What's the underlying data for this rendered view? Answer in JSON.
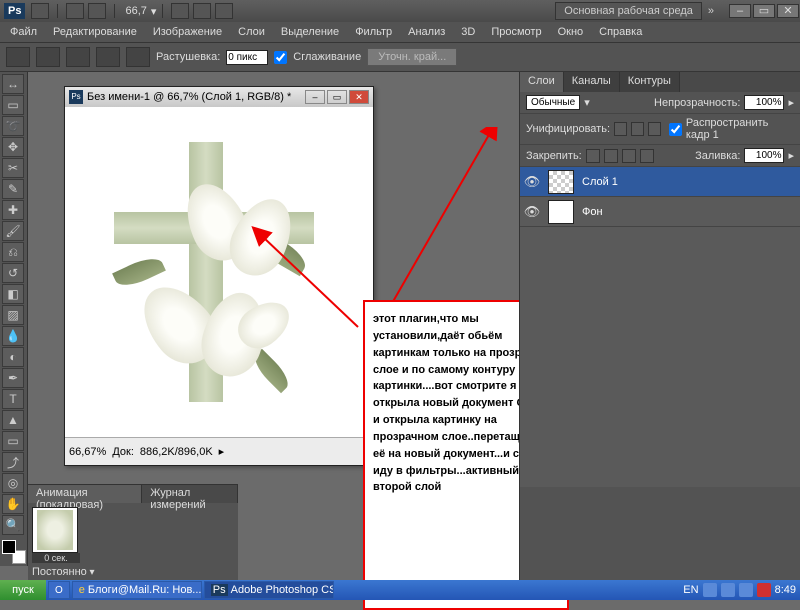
{
  "titlebar": {
    "ps": "Ps",
    "zoom": "66,7",
    "workspace": "Основная рабочая среда"
  },
  "menu": {
    "file": "Файл",
    "edit": "Редактирование",
    "image": "Изображение",
    "layers": "Слои",
    "select": "Выделение",
    "filter": "Фильтр",
    "analysis": "Анализ",
    "d3": "3D",
    "view": "Просмотр",
    "window": "Окно",
    "help": "Справка"
  },
  "optbar": {
    "feather_label": "Растушевка:",
    "feather_value": "0 пикс",
    "aa_label": "Сглаживание",
    "aa_checked": true,
    "refine": "Уточн. край..."
  },
  "doc": {
    "title": "Без имени-1 @ 66,7% (Слой 1, RGB/8) *",
    "zoom": "66,67%",
    "doc_label": "Док:",
    "doc_size": "886,2K/896,0K"
  },
  "annotation": {
    "text": "этот плагин,что мы установили,даёт обьём картинкам только на прозрачном слое и по самому контуру картинки....вот смотрите я открыла новый документ Ctrl+N  и открыла картинку на прозрачном слое..перетащщила её на новый документ...и сейчас иду в фильтры...активный у меня второй слой"
  },
  "anim": {
    "tab1": "Анимация (покадровая)",
    "tab2": "Журнал измерений",
    "time": "0 сек.",
    "loop": "Постоянно"
  },
  "layers_panel": {
    "tabs": {
      "layers": "Слои",
      "channels": "Каналы",
      "paths": "Контуры"
    },
    "blend": "Обычные",
    "opacity_label": "Непрозрачность:",
    "opacity": "100%",
    "unify": "Унифицировать:",
    "propagate": "Распространить кадр 1",
    "lock": "Закрепить:",
    "fill_label": "Заливка:",
    "fill": "100%",
    "rows": [
      {
        "name": "Слой 1",
        "active": true
      },
      {
        "name": "Фон",
        "active": false
      }
    ]
  },
  "taskbar": {
    "start": "пуск",
    "b1": "Блоги@Mail.Ru: Нов...",
    "b2": "Adobe Photoshop CS...",
    "lang": "EN",
    "clock": "8:49"
  }
}
